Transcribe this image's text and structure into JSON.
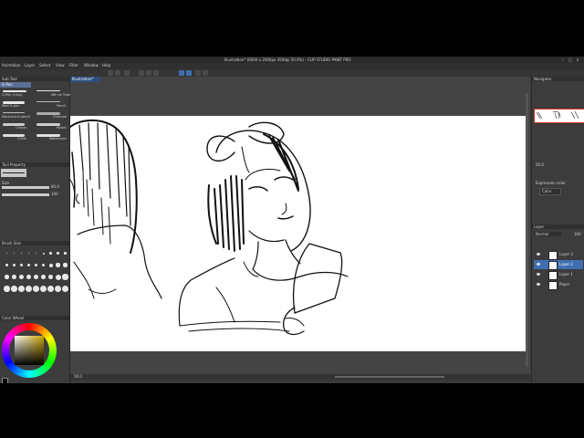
{
  "window": {
    "title": "Illustration* (6000 x 2000px 350dpi 50.0%) - CLIP STUDIO PAINT PRO",
    "controls": [
      "–",
      "□",
      "×"
    ]
  },
  "menu": [
    "Animation",
    "Layer",
    "Select",
    "View",
    "Filter",
    "Window",
    "Help"
  ],
  "document_tab": "Illustration*",
  "left_panel": {
    "tool_header": "Sub Tool",
    "brush_group_tab": "G Pen",
    "brushes": [
      {
        "name": "G-Pen (crisp)"
      },
      {
        "name": "MB Ink Traditional"
      },
      {
        "name": "Real G-pen"
      },
      {
        "name": "Pencil"
      },
      {
        "name": "Mechanical pencil"
      },
      {
        "name": "Charcoal"
      },
      {
        "name": "Crayon"
      },
      {
        "name": "Pastel"
      },
      {
        "name": "Chalk"
      },
      {
        "name": "Watercolor"
      }
    ],
    "tool_property_header": "Tool Property",
    "size_label": "Size",
    "size_value": "80.0",
    "opacity_value": "100",
    "brush_size_header": "Brush Size",
    "color_wheel_header": "Color Wheel"
  },
  "right_panel": {
    "navigator_header": "Navigator",
    "zoom": "50.0",
    "expression_label": "Expression color",
    "expression_value": "Color",
    "layer_header": "Layer",
    "blend_mode": "Normal",
    "opacity": "100",
    "layers": [
      {
        "name": "Layer 3"
      },
      {
        "name": "Layer 2"
      },
      {
        "name": "Layer 1"
      },
      {
        "name": "Paper"
      }
    ]
  },
  "statusbar": {
    "zoom": "50.0"
  },
  "colors": {
    "accent": "#3f6fb0",
    "panel": "#3c3c3c",
    "canvas_bg": "#444444",
    "paper": "#ffffff",
    "main_color": "#000000",
    "sub_color": "#ffffff"
  }
}
